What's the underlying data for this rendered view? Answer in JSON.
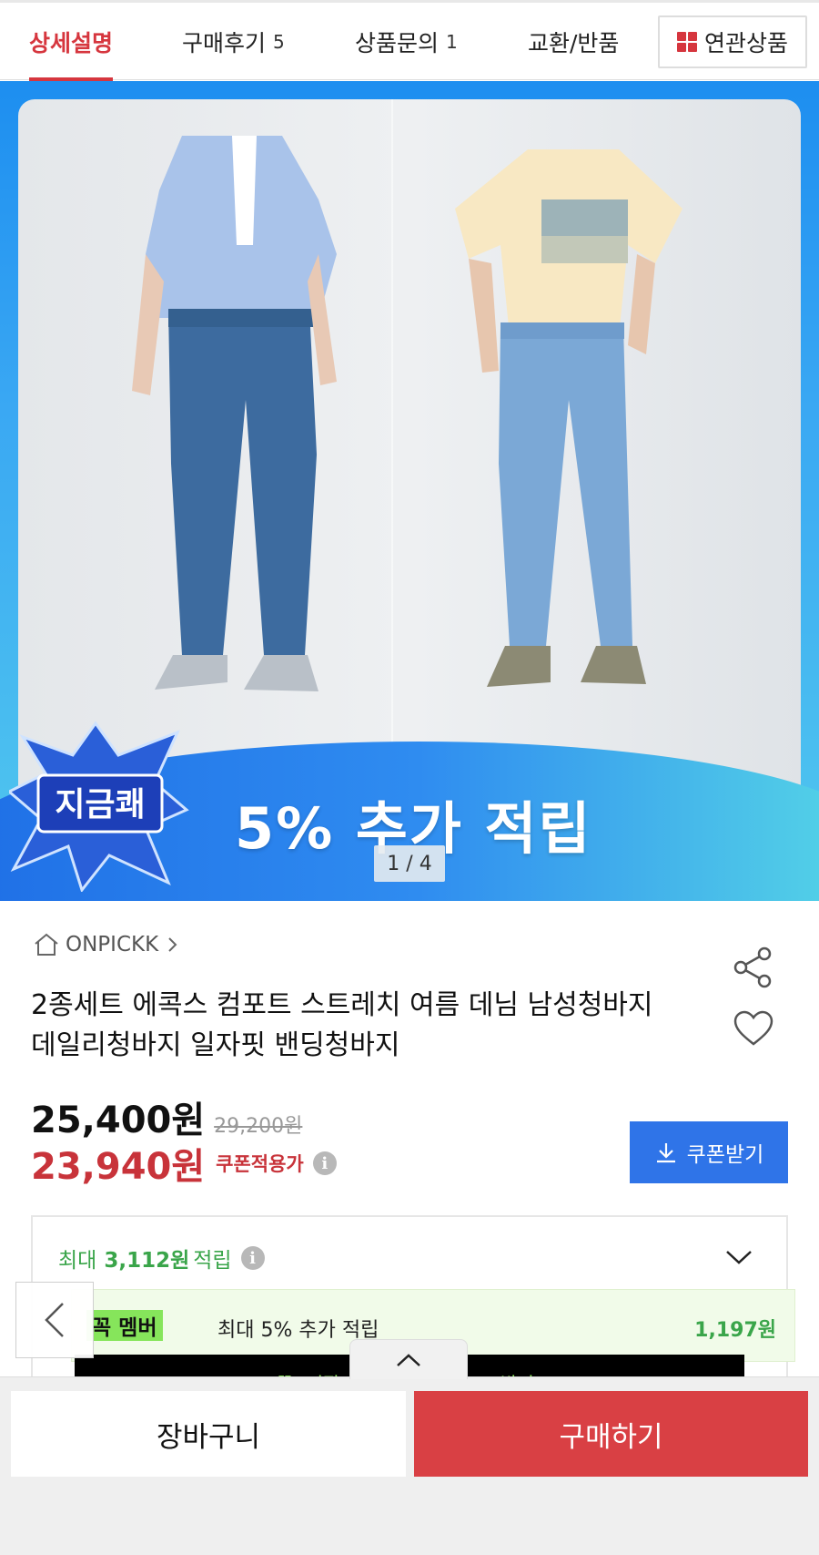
{
  "tabs": [
    {
      "label": "상세설명",
      "count": ""
    },
    {
      "label": "구매후기",
      "count": "5"
    },
    {
      "label": "상품문의",
      "count": "1"
    },
    {
      "label": "교환/반품",
      "count": ""
    }
  ],
  "related_label": "연관상품",
  "hero": {
    "badge_text": "지금쾌",
    "promo": "5% 추가 적립",
    "pager": "1 / 4"
  },
  "product": {
    "store": "ONPICKK",
    "title": "2종세트 에콕스 컴포트 스트레치 여름 데님 남성청바지 데일리청바지 일자핏 밴딩청바지",
    "price": "25,400원",
    "original_price": "29,200원",
    "coupon_price": "23,940원",
    "coupon_label": "쿠폰적용가",
    "coupon_button": "쿠폰받기"
  },
  "points": {
    "prefix": "최대",
    "amount": "3,112원",
    "suffix": "적립",
    "member_tag": "꼭 멤버",
    "member_text": "최대 5% 추가 적립",
    "member_amount": "1,197원",
    "banner_left": "꼭! 시작",
    "banner_right": "받기 >"
  },
  "bottom": {
    "cart": "장바구니",
    "buy": "구매하기"
  },
  "colors": {
    "accent_red": "#d6363e",
    "coupon_blue": "#2f74e8",
    "points_green": "#3aa54a"
  }
}
